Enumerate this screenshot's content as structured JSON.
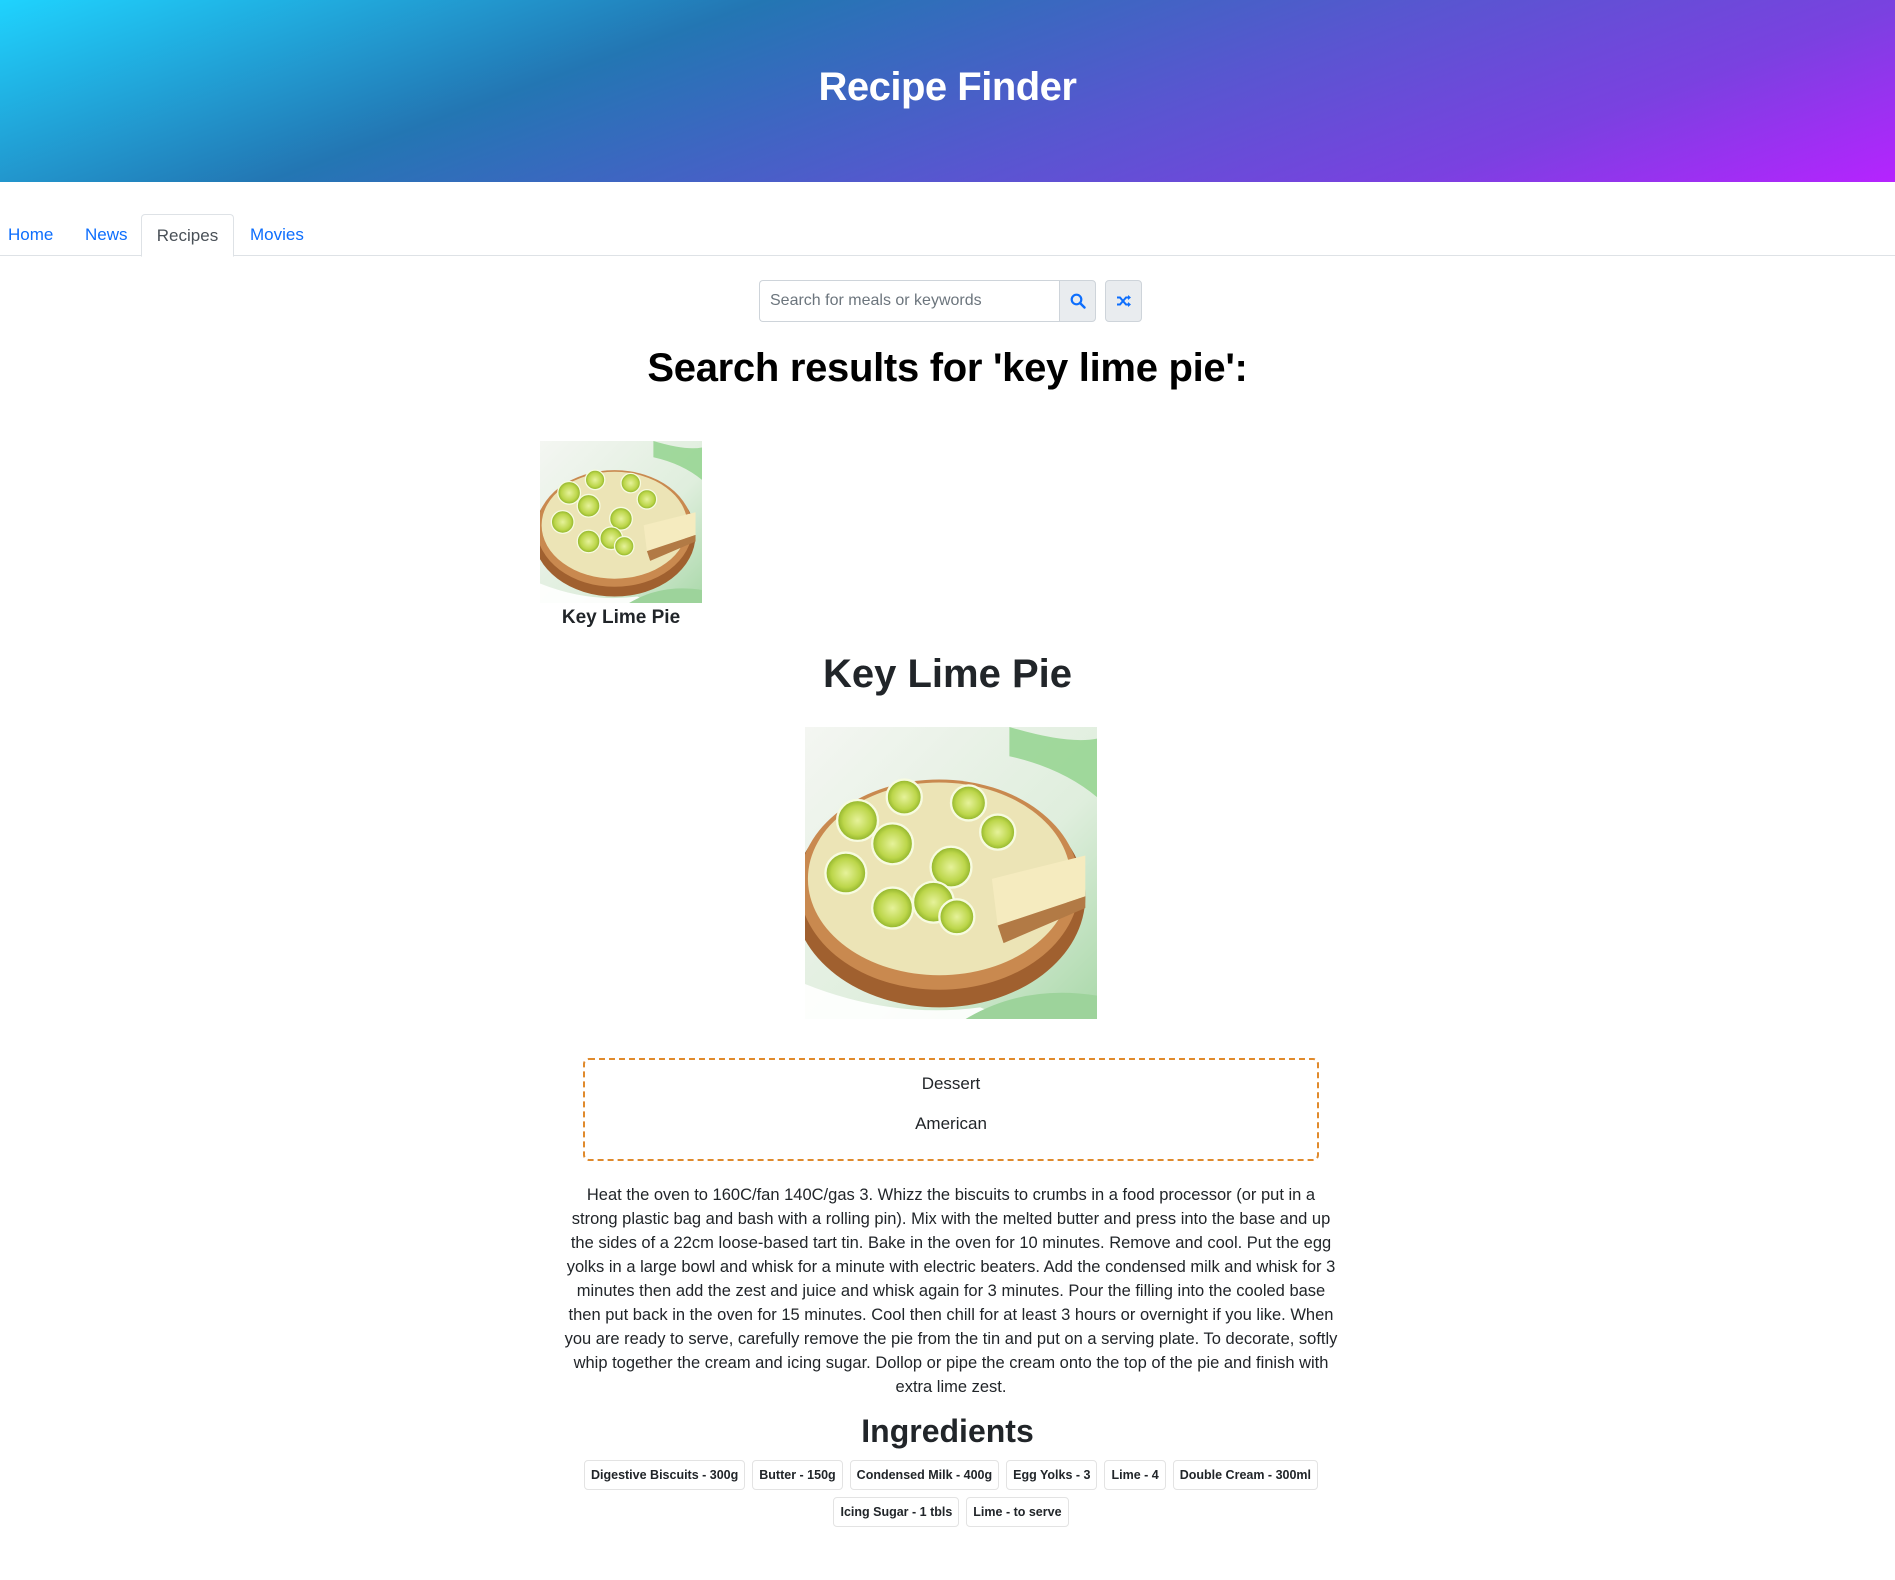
{
  "app": {
    "title": "Recipe Finder"
  },
  "tabs": [
    {
      "label": "Home",
      "active": false
    },
    {
      "label": "News",
      "active": false
    },
    {
      "label": "Recipes",
      "active": true
    },
    {
      "label": "Movies",
      "active": false
    }
  ],
  "search": {
    "placeholder": "Search for meals or keywords",
    "value": "",
    "search_icon": "search-icon",
    "random_icon": "shuffle-icon"
  },
  "results": {
    "heading": "Search results for 'key lime pie':",
    "items": [
      {
        "caption": "Key Lime Pie"
      }
    ]
  },
  "meal": {
    "title": "Key Lime Pie",
    "category": "Dessert",
    "area": "American",
    "instructions": "Heat the oven to 160C/fan 140C/gas 3. Whizz the biscuits to crumbs in a food processor (or put in a strong plastic bag and bash with a rolling pin). Mix with the melted butter and press into the base and up the sides of a 22cm loose-based tart tin. Bake in the oven for 10 minutes. Remove and cool. Put the egg yolks in a large bowl and whisk for a minute with electric beaters. Add the condensed milk and whisk for 3 minutes then add the zest and juice and whisk again for 3 minutes. Pour the filling into the cooled base then put back in the oven for 15 minutes. Cool then chill for at least 3 hours or overnight if you like. When you are ready to serve, carefully remove the pie from the tin and put on a serving plate. To decorate, softly whip together the cream and icing sugar. Dollop or pipe the cream onto the top of the pie and finish with extra lime zest.",
    "ingredients_heading": "Ingredients",
    "ingredients": [
      "Digestive Biscuits - 300g",
      "Butter - 150g",
      "Condensed Milk - 400g",
      "Egg Yolks - 3",
      "Lime - 4",
      "Double Cream - 300ml",
      "Icing Sugar - 1 tbls",
      "Lime - to serve"
    ]
  },
  "colors": {
    "link": "#0d6efd",
    "tag_border": "#e08a2c",
    "gradient_start": "#1fd3fe",
    "gradient_end": "#b623ff"
  }
}
